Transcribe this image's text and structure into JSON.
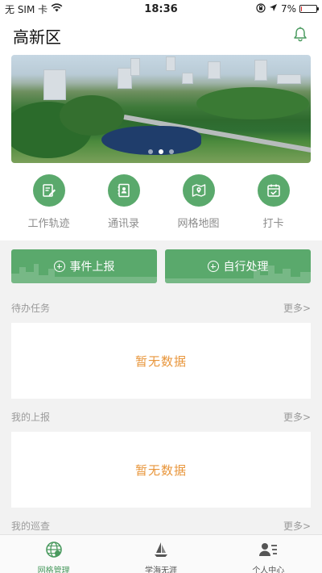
{
  "status_bar": {
    "carrier": "无 SIM 卡",
    "time": "18:36",
    "battery": "7%",
    "battery_level": 0.07
  },
  "header": {
    "title": "高新区",
    "bell_icon": "bell-icon"
  },
  "banner": {
    "slide_count": 3,
    "active_slide": 2
  },
  "quick_menu": [
    {
      "label": "工作轨迹",
      "icon": "edit-note-icon"
    },
    {
      "label": "通讯录",
      "icon": "contacts-book-icon"
    },
    {
      "label": "网格地图",
      "icon": "map-pin-icon"
    },
    {
      "label": "打卡",
      "icon": "calendar-check-icon"
    }
  ],
  "actions": {
    "report": "事件上报",
    "self_handle": "自行处理"
  },
  "sections": {
    "pending": {
      "title": "待办任务",
      "more": "更多>",
      "empty": "暂无数据"
    },
    "my_reports": {
      "title": "我的上报",
      "more": "更多>",
      "empty": "暂无数据"
    },
    "my_patrol": {
      "title": "我的巡查",
      "more": "更多>"
    }
  },
  "tabbar": [
    {
      "label": "网格管理",
      "icon": "globe-grid-icon",
      "active": true
    },
    {
      "label": "学海无涯",
      "icon": "sailboat-icon",
      "active": false
    },
    {
      "label": "个人中心",
      "icon": "person-list-icon",
      "active": false
    }
  ],
  "colors": {
    "accent": "#5aa96c",
    "empty_text": "#e8963c",
    "battery_low": "#e02020"
  }
}
